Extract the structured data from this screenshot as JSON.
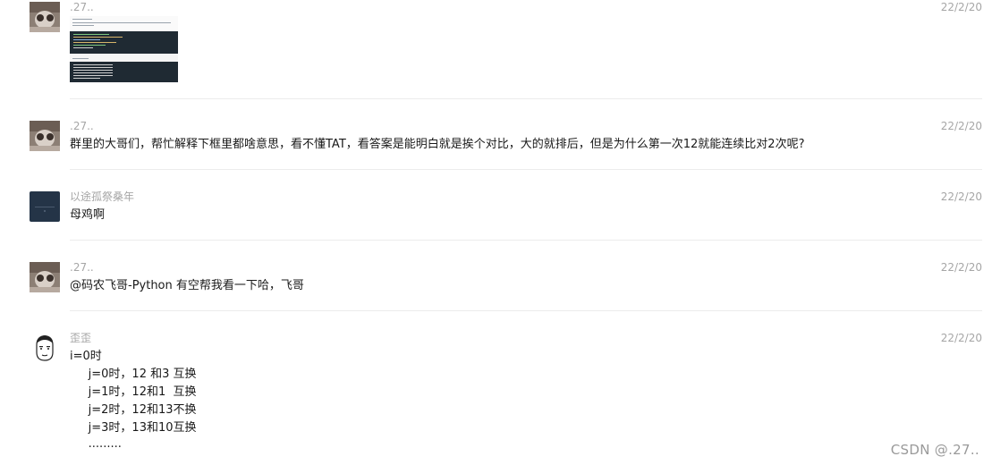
{
  "messages": [
    {
      "sender": ".27..",
      "time": "22/2/20",
      "type": "image",
      "image_icon": "code-screenshot-thumbnail"
    },
    {
      "sender": ".27..",
      "time": "22/2/20",
      "text": "群里的大哥们，帮忙解释下框里都啥意思，看不懂TAT，看答案是能明白就是挨个对比，大的就排后，但是为什么第一次12就能连续比对2次呢?"
    },
    {
      "sender": "以途孤祭桑年",
      "time": "22/2/20",
      "text": "母鸡啊"
    },
    {
      "sender": ".27..",
      "time": "22/2/20",
      "text": "@码农飞哥-Python 有空帮我看一下哈，飞哥"
    },
    {
      "sender": "歪歪",
      "time": "22/2/20",
      "lines": [
        "i=0时",
        "     j=0时，12 和3 互换",
        "     j=1时，12和1  互换",
        "     j=2时，12和13不换",
        "     j=3时，13和10互换",
        "     ........."
      ]
    }
  ],
  "watermark": "CSDN @.27..",
  "colors": {
    "sender": "#a6a6a6",
    "text": "#191919",
    "divider": "#ececec",
    "avatar_dark": "#243447"
  }
}
